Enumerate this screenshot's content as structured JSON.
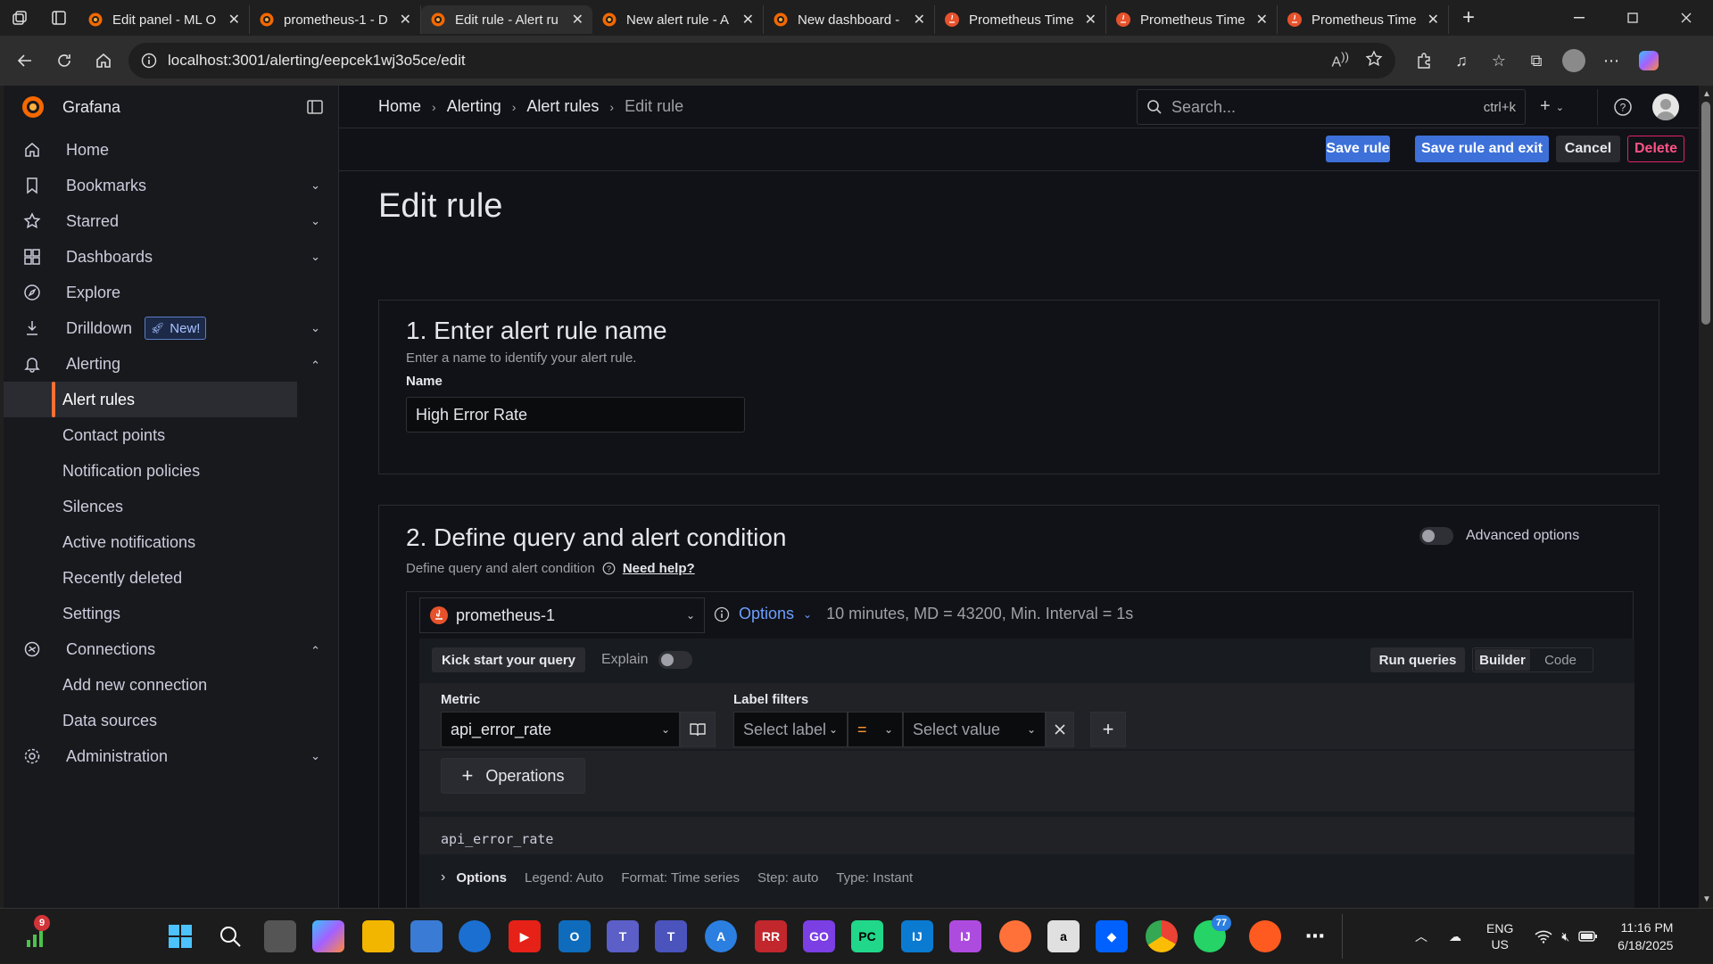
{
  "browser": {
    "tabs": [
      {
        "title": "Edit panel - ML O",
        "icon": "grafana-icon",
        "active": false
      },
      {
        "title": "prometheus-1 - D",
        "icon": "grafana-icon",
        "active": false
      },
      {
        "title": "Edit rule - Alert ru",
        "icon": "grafana-icon",
        "active": true
      },
      {
        "title": "New alert rule - A",
        "icon": "grafana-icon",
        "active": false
      },
      {
        "title": "New dashboard -",
        "icon": "grafana-icon",
        "active": false
      },
      {
        "title": "Prometheus Time",
        "icon": "prometheus-icon",
        "active": false
      },
      {
        "title": "Prometheus Time",
        "icon": "prometheus-icon",
        "active": false
      },
      {
        "title": "Prometheus Time",
        "icon": "prometheus-icon",
        "active": false
      }
    ],
    "url": "localhost:3001/alerting/eepcek1wj3o5ce/edit"
  },
  "sidebar": {
    "brand": "Grafana",
    "items": [
      {
        "label": "Home",
        "icon": "home-icon"
      },
      {
        "label": "Bookmarks",
        "icon": "bookmark-icon",
        "chevron": "down"
      },
      {
        "label": "Starred",
        "icon": "star-icon",
        "chevron": "down"
      },
      {
        "label": "Dashboards",
        "icon": "dashboards-grid-icon",
        "chevron": "down"
      },
      {
        "label": "Explore",
        "icon": "compass-icon"
      },
      {
        "label": "Drilldown",
        "icon": "drilldown-icon",
        "chevron": "down",
        "badge": "New!"
      },
      {
        "label": "Alerting",
        "icon": "bell-icon",
        "chevron": "up"
      }
    ],
    "alerting_sub": [
      "Alert rules",
      "Contact points",
      "Notification policies",
      "Silences",
      "Active notifications",
      "Recently deleted",
      "Settings"
    ],
    "connections": {
      "label": "Connections",
      "icon": "connections-icon",
      "chevron": "up"
    },
    "connections_sub": [
      "Add new connection",
      "Data sources"
    ],
    "administration": {
      "label": "Administration",
      "icon": "gear-icon",
      "chevron": "down"
    }
  },
  "topnav": {
    "breadcrumbs": [
      "Home",
      "Alerting",
      "Alert rules",
      "Edit rule"
    ],
    "search_placeholder": "Search...",
    "search_shortcut": "ctrl+k"
  },
  "toolbar": {
    "save": "Save rule",
    "save_exit": "Save rule and exit",
    "cancel": "Cancel",
    "delete": "Delete"
  },
  "page": {
    "title": "Edit rule",
    "section1": {
      "title": "1. Enter alert rule name",
      "desc": "Enter a name to identify your alert rule.",
      "name_label": "Name",
      "name_value": "High Error Rate"
    },
    "section2": {
      "title": "2. Define query and alert condition",
      "desc": "Define query and alert condition",
      "help": "Need help?",
      "advanced": "Advanced options",
      "datasource": "prometheus-1",
      "options_label": "Options",
      "options_summary": "10 minutes, MD = 43200, Min. Interval = 1s",
      "kickstart": "Kick start your query",
      "explain": "Explain",
      "run_queries": "Run queries",
      "mode_builder": "Builder",
      "mode_code": "Code",
      "metric_label": "Metric",
      "metric_value": "api_error_rate",
      "label_filters": "Label filters",
      "select_label": "Select label",
      "operator": "=",
      "select_value": "Select value",
      "operations": "Operations",
      "query_preview": "api_error_rate",
      "q_options": "Options",
      "legend": "Legend: Auto",
      "format": "Format: Time series",
      "step": "Step: auto",
      "type": "Type: Instant"
    }
  },
  "taskbar": {
    "notification_count": "9",
    "whatsapp_count": "77",
    "lang": "ENG",
    "region": "US",
    "time": "11:16 PM",
    "date": "6/18/2025"
  }
}
